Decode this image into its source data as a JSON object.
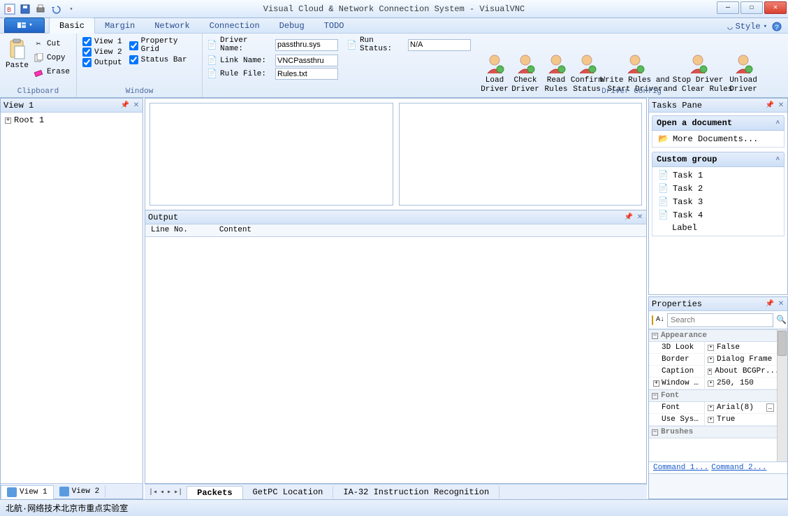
{
  "title": "Visual Cloud & Network Connection System - VisualVNC",
  "qat": {
    "save_icon": "save-icon",
    "print_icon": "print-icon",
    "undo_icon": "undo-icon"
  },
  "tabs": {
    "basic": "Basic",
    "margin": "Margin",
    "network": "Network",
    "connection": "Connection",
    "debug": "Debug",
    "todo": "TODO"
  },
  "style_label": "Style",
  "ribbon": {
    "clipboard": {
      "title": "Clipboard",
      "paste": "Paste",
      "cut": "Cut",
      "copy": "Copy",
      "erase": "Erase"
    },
    "window": {
      "title": "Window",
      "view1": "View 1",
      "view2": "View 2",
      "output": "Output",
      "propgrid": "Property Grid",
      "statusbar": "Status Bar"
    },
    "driverinfo": {
      "driver_label": "Driver Name:",
      "driver_val": "passthru.sys",
      "link_label": "Link   Name:",
      "link_val": "VNCPassthru",
      "rule_label": "Rule   File:",
      "rule_val": "Rules.txt",
      "run_label": "Run Status:",
      "run_val": "N/A"
    },
    "driverconfig": {
      "title": "Driver Config",
      "load": "Load\nDriver",
      "check": "Check\nDriver",
      "read": "Read\nRules",
      "confirm": "Confirm\nStatus",
      "write": "Write Rules and\nStart Driver",
      "stop": "Stop Driver\nand Clear Rules",
      "unload": "Unload\nDriver"
    }
  },
  "leftpane": {
    "title": "View  1",
    "root": "Root 1",
    "tab1": "View  1",
    "tab2": "View 2"
  },
  "output": {
    "title": "Output",
    "col1": "Line No.",
    "col2": "Content"
  },
  "center_tabs": {
    "packets": "Packets",
    "getpc": "GetPC Location",
    "ia32": "IA-32 Instruction Recognition"
  },
  "tasks": {
    "title": "Tasks Pane",
    "g1_title": "Open a document",
    "more": "More Documents...",
    "g2_title": "Custom group",
    "t1": "Task 1",
    "t2": "Task 2",
    "t3": "Task 3",
    "t4": "Task 4",
    "label": "Label"
  },
  "props": {
    "title": "Properties",
    "search_ph": "Search",
    "cat_appearance": "Appearance",
    "r1n": "3D Look",
    "r1v": "False",
    "r2n": "Border",
    "r2v": "Dialog Frame",
    "r3n": "Caption",
    "r3v": "About BCGPr...",
    "r4n": "Window S...",
    "r4v": "250, 150",
    "cat_font": "Font",
    "r5n": "Font",
    "r5v": "Arial(8)",
    "r6n": "Use Syste...",
    "r6v": "True",
    "cat_brushes": "Brushes",
    "cmd1": "Command 1...",
    "cmd2": "Command 2..."
  },
  "status": "北航·网络技术北京市重点实验室"
}
